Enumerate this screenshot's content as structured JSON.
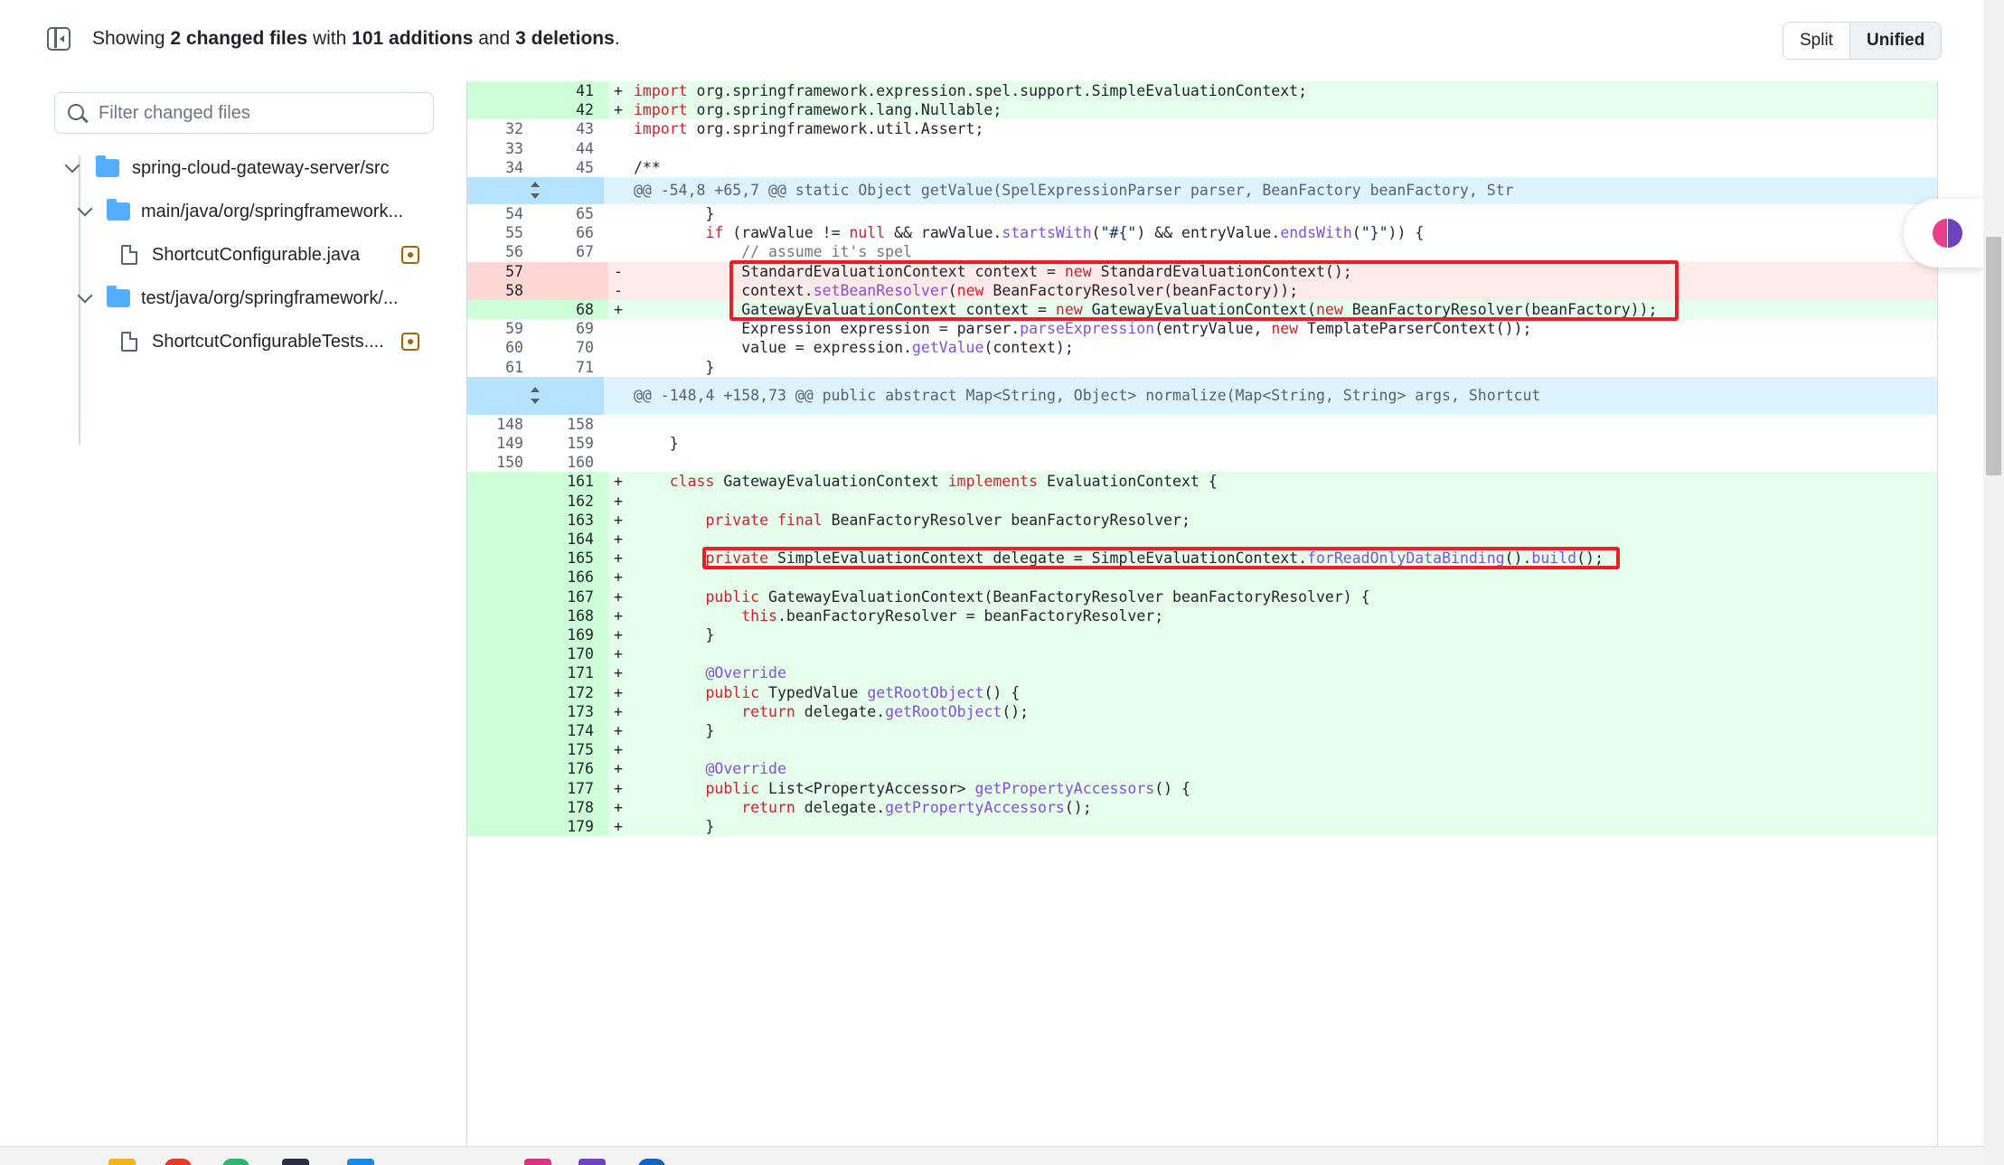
{
  "header": {
    "summary_prefix": "Showing",
    "changed_count": "2 changed files",
    "summary_with": "with",
    "additions": "101 additions",
    "summary_and": "and",
    "deletions": "3 deletions",
    "summary_end": ".",
    "split_label": "Split",
    "unified_label": "Unified",
    "active_view": "Unified"
  },
  "sidebar": {
    "filter_placeholder": "Filter changed files",
    "tree": [
      {
        "label": "spring-cloud-gateway-server/src",
        "kind": "folder"
      },
      {
        "label": "main/java/org/springframework...",
        "kind": "folder"
      },
      {
        "label": "ShortcutConfigurable.java",
        "kind": "file",
        "status": "modified"
      },
      {
        "label": "test/java/org/springframework/...",
        "kind": "folder"
      },
      {
        "label": "ShortcutConfigurableTests....",
        "kind": "file",
        "status": "modified"
      }
    ]
  },
  "diff": {
    "rows": [
      {
        "type": "add",
        "old": "",
        "new": "41",
        "sign": "+",
        "code": "import org.springframework.expression.spel.support.SimpleEvaluationContext;"
      },
      {
        "type": "add",
        "old": "",
        "new": "42",
        "sign": "+",
        "code": "import org.springframework.lang.Nullable;"
      },
      {
        "type": "ctx",
        "old": "32",
        "new": "43",
        "sign": "",
        "code": "import org.springframework.util.Assert;"
      },
      {
        "type": "ctx",
        "old": "33",
        "new": "44",
        "sign": "",
        "code": ""
      },
      {
        "type": "ctx",
        "old": "34",
        "new": "45",
        "sign": "",
        "code": "/**"
      },
      {
        "type": "hunk",
        "code": "@@ -54,8 +65,7 @@ static Object getValue(SpelExpressionParser parser, BeanFactory beanFactory, Str"
      },
      {
        "type": "ctx",
        "old": "54",
        "new": "65",
        "sign": "",
        "code": "        }"
      },
      {
        "type": "ctx",
        "old": "55",
        "new": "66",
        "sign": "",
        "code": "        if (rawValue != null && rawValue.startsWith(\"#{\") && entryValue.endsWith(\"}\")) {"
      },
      {
        "type": "ctx",
        "old": "56",
        "new": "67",
        "sign": "",
        "code": "            // assume it's spel"
      },
      {
        "type": "del",
        "old": "57",
        "new": "",
        "sign": "-",
        "code": "            StandardEvaluationContext context = new StandardEvaluationContext();"
      },
      {
        "type": "del",
        "old": "58",
        "new": "",
        "sign": "-",
        "code": "            context.setBeanResolver(new BeanFactoryResolver(beanFactory));"
      },
      {
        "type": "add",
        "old": "",
        "new": "68",
        "sign": "+",
        "code": "            GatewayEvaluationContext context = new GatewayEvaluationContext(new BeanFactoryResolver(beanFactory));"
      },
      {
        "type": "ctx",
        "old": "59",
        "new": "69",
        "sign": "",
        "code": "            Expression expression = parser.parseExpression(entryValue, new TemplateParserContext());"
      },
      {
        "type": "ctx",
        "old": "60",
        "new": "70",
        "sign": "",
        "code": "            value = expression.getValue(context);"
      },
      {
        "type": "ctx",
        "old": "61",
        "new": "71",
        "sign": "",
        "code": "        }"
      },
      {
        "type": "hunk",
        "code": "@@ -148,4 +158,73 @@ public abstract Map<String, Object> normalize(Map<String, String> args, Shortcut"
      },
      {
        "type": "ctx",
        "old": "148",
        "new": "158",
        "sign": "",
        "code": ""
      },
      {
        "type": "ctx",
        "old": "149",
        "new": "159",
        "sign": "",
        "code": "    }"
      },
      {
        "type": "ctx",
        "old": "150",
        "new": "160",
        "sign": "",
        "code": ""
      },
      {
        "type": "add",
        "old": "",
        "new": "161",
        "sign": "+",
        "code": "    class GatewayEvaluationContext implements EvaluationContext {"
      },
      {
        "type": "add",
        "old": "",
        "new": "162",
        "sign": "+",
        "code": ""
      },
      {
        "type": "add",
        "old": "",
        "new": "163",
        "sign": "+",
        "code": "        private final BeanFactoryResolver beanFactoryResolver;"
      },
      {
        "type": "add",
        "old": "",
        "new": "164",
        "sign": "+",
        "code": ""
      },
      {
        "type": "add",
        "old": "",
        "new": "165",
        "sign": "+",
        "code": "        private SimpleEvaluationContext delegate = SimpleEvaluationContext.forReadOnlyDataBinding().build();"
      },
      {
        "type": "add",
        "old": "",
        "new": "166",
        "sign": "+",
        "code": ""
      },
      {
        "type": "add",
        "old": "",
        "new": "167",
        "sign": "+",
        "code": "        public GatewayEvaluationContext(BeanFactoryResolver beanFactoryResolver) {"
      },
      {
        "type": "add",
        "old": "",
        "new": "168",
        "sign": "+",
        "code": "            this.beanFactoryResolver = beanFactoryResolver;"
      },
      {
        "type": "add",
        "old": "",
        "new": "169",
        "sign": "+",
        "code": "        }"
      },
      {
        "type": "add",
        "old": "",
        "new": "170",
        "sign": "+",
        "code": ""
      },
      {
        "type": "add",
        "old": "",
        "new": "171",
        "sign": "+",
        "code": "        @Override"
      },
      {
        "type": "add",
        "old": "",
        "new": "172",
        "sign": "+",
        "code": "        public TypedValue getRootObject() {"
      },
      {
        "type": "add",
        "old": "",
        "new": "173",
        "sign": "+",
        "code": "            return delegate.getRootObject();"
      },
      {
        "type": "add",
        "old": "",
        "new": "174",
        "sign": "+",
        "code": "        }"
      },
      {
        "type": "add",
        "old": "",
        "new": "175",
        "sign": "+",
        "code": ""
      },
      {
        "type": "add",
        "old": "",
        "new": "176",
        "sign": "+",
        "code": "        @Override"
      },
      {
        "type": "add",
        "old": "",
        "new": "177",
        "sign": "+",
        "code": "        public List<PropertyAccessor> getPropertyAccessors() {"
      },
      {
        "type": "add",
        "old": "",
        "new": "178",
        "sign": "+",
        "code": "            return delegate.getPropertyAccessors();"
      },
      {
        "type": "add",
        "old": "",
        "new": "179",
        "sign": "+",
        "code": "        }"
      }
    ]
  },
  "colors": {
    "addition_bg": "#e6ffec",
    "addition_gutter": "#ccffd8",
    "deletion_bg": "#ffebe9",
    "deletion_gutter": "#ffd7d5",
    "hunk_bg": "#ddf4ff",
    "highlight_box": "#ee1c25",
    "keyword": "#cf222e",
    "method": "#8250df",
    "folder": "#54aeff",
    "modified": "#9a6700"
  },
  "icons": [
    "sidebar-toggle-icon",
    "search-icon",
    "chevron-down-icon",
    "folder-icon",
    "file-icon",
    "file-modified-icon",
    "expand-icon",
    "brain-icon"
  ]
}
